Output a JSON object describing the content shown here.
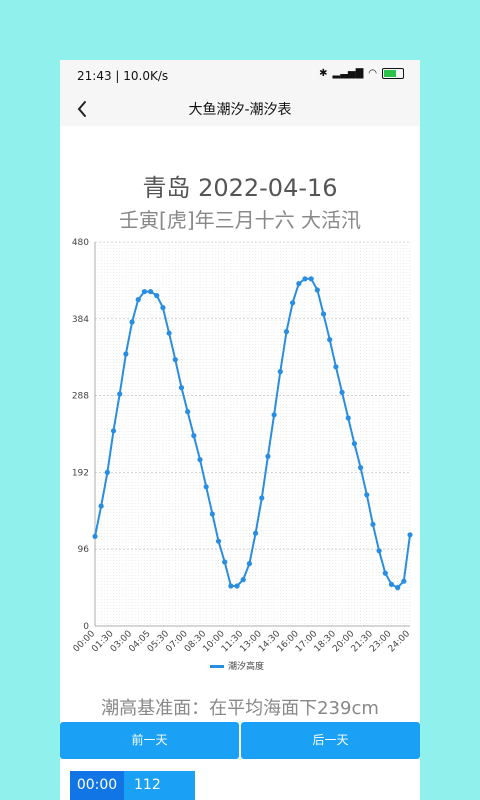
{
  "status": {
    "time_speed": "21:43 | 10.0K/s",
    "battery": ""
  },
  "appbar": {
    "title": "大鱼潮汐-潮汐表"
  },
  "header": {
    "city_date": "青岛  2022-04-16",
    "lunar": "壬寅[虎]年三月十六  大活汛"
  },
  "chart_data": {
    "type": "line",
    "ylim": [
      0,
      480
    ],
    "yticks": [
      "0",
      "96",
      "192",
      "288",
      "384",
      "480"
    ],
    "xtick_labels": [
      "00:00",
      "01:30",
      "03:00",
      "04:05",
      "05:30",
      "07:00",
      "08:30",
      "10:00",
      "11:30",
      "13:00",
      "14:30",
      "16:00",
      "17:00",
      "18:30",
      "20:00",
      "21:30",
      "23:00",
      "24:00"
    ],
    "series": [
      {
        "name": "潮汐高度",
        "color": "#2a8ee0",
        "values": [
          112,
          150,
          192,
          244,
          290,
          340,
          380,
          408,
          418,
          418,
          413,
          398,
          366,
          333,
          298,
          268,
          238,
          208,
          174,
          140,
          106,
          80,
          50,
          50,
          58,
          78,
          116,
          160,
          212,
          264,
          318,
          368,
          404,
          428,
          434,
          434,
          420,
          390,
          358,
          324,
          292,
          260,
          228,
          198,
          164,
          127,
          94,
          66,
          52,
          48,
          56,
          114
        ]
      }
    ]
  },
  "baseline_note": "潮高基准面：在平均海面下239cm",
  "buttons": {
    "prev": "前一天",
    "next": "后一天"
  },
  "table": {
    "first_time": "00:00",
    "first_value": "112"
  }
}
